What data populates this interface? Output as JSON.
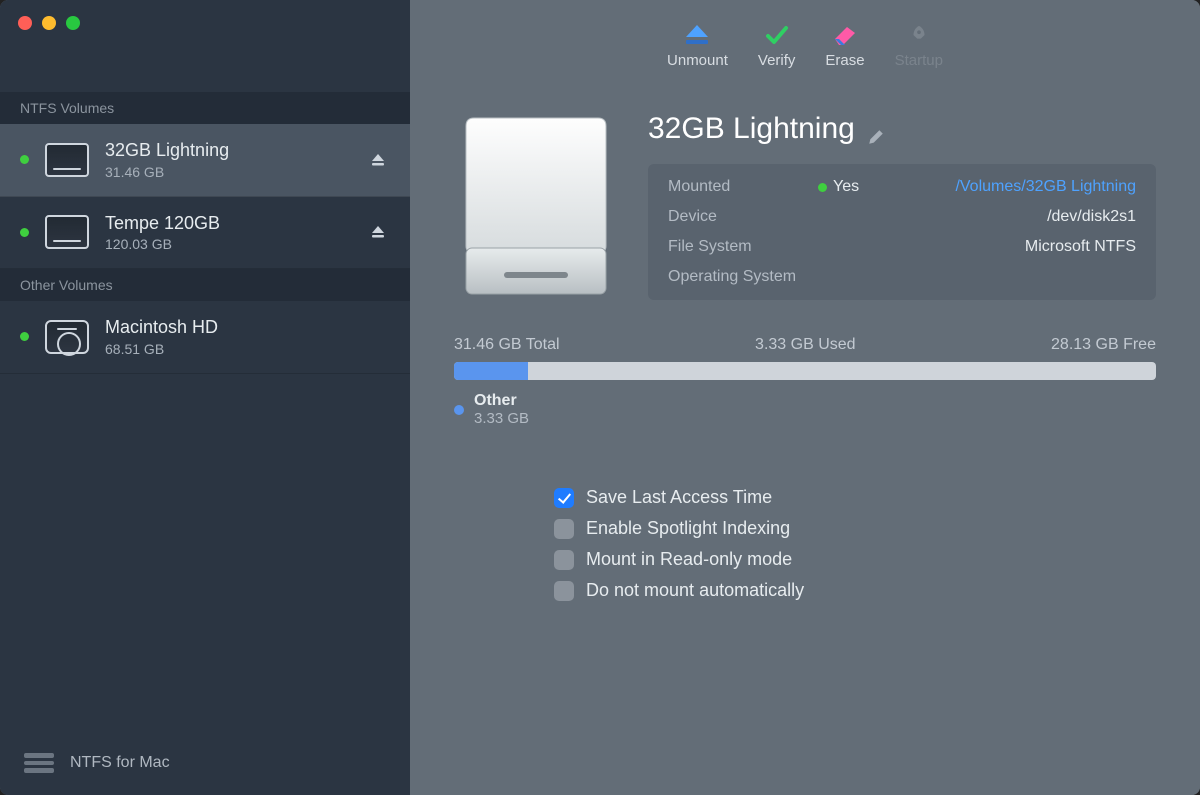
{
  "sidebar": {
    "section_ntfs": "NTFS Volumes",
    "section_other": "Other Volumes",
    "volumes_ntfs": [
      {
        "name": "32GB Lightning",
        "size": "31.46 GB",
        "online": true,
        "ejectable": true,
        "selected": true
      },
      {
        "name": "Tempe 120GB",
        "size": "120.03 GB",
        "online": true,
        "ejectable": true,
        "selected": false
      }
    ],
    "volumes_other": [
      {
        "name": "Macintosh HD",
        "size": "68.51 GB",
        "online": true,
        "ejectable": false
      }
    ],
    "footer": "NTFS for Mac"
  },
  "toolbar": {
    "unmount": "Unmount",
    "verify": "Verify",
    "erase": "Erase",
    "startup": "Startup"
  },
  "volume": {
    "title": "32GB Lightning",
    "rows": {
      "mounted_label": "Mounted",
      "mounted_value": "Yes",
      "mounted_path": "/Volumes/32GB Lightning",
      "device_label": "Device",
      "device_value": "/dev/disk2s1",
      "fs_label": "File System",
      "fs_value": "Microsoft NTFS",
      "os_label": "Operating System",
      "os_value": ""
    },
    "usage": {
      "total": "31.46 GB Total",
      "used": "3.33 GB Used",
      "free": "28.13 GB Free",
      "fill_percent": 10.6,
      "legend_name": "Other",
      "legend_size": "3.33 GB"
    },
    "options": {
      "save_access": {
        "label": "Save Last Access Time",
        "checked": true
      },
      "spotlight": {
        "label": "Enable Spotlight Indexing",
        "checked": false
      },
      "readonly": {
        "label": "Mount in Read-only mode",
        "checked": false
      },
      "no_auto_mount": {
        "label": "Do not mount automatically",
        "checked": false
      }
    }
  },
  "colors": {
    "accent": "#5a95ee",
    "link": "#4ea2ff",
    "green": "#3fcf3f"
  }
}
